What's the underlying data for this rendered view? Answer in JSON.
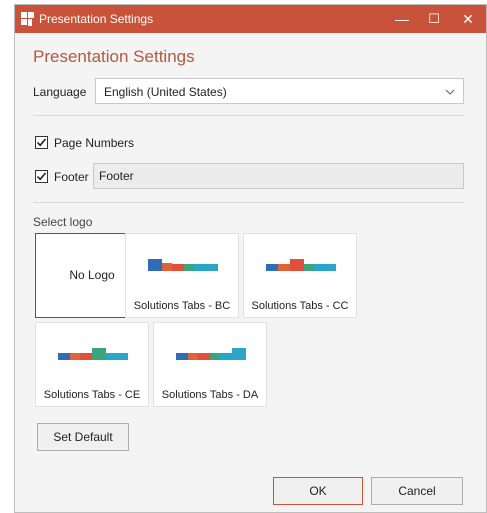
{
  "window": {
    "title": "Presentation Settings",
    "controls": {
      "minimize": "—",
      "maximize": "☐",
      "close": "✕"
    },
    "accent_color": "#c8533a"
  },
  "heading": "Presentation Settings",
  "language": {
    "label": "Language",
    "value": "English (United States)"
  },
  "page_numbers": {
    "label": "Page Numbers",
    "checked": true
  },
  "footer": {
    "label": "Footer",
    "checked": true,
    "value": "Footer"
  },
  "logo_section": {
    "label": "Select logo",
    "tiles": [
      {
        "caption": "No Logo",
        "selected": true
      },
      {
        "caption": "Solutions Tabs - BC"
      },
      {
        "caption": "Solutions Tabs - CC"
      },
      {
        "caption": "Solutions Tabs - CE"
      },
      {
        "caption": "Solutions Tabs - DA"
      }
    ]
  },
  "buttons": {
    "set_default": "Set Default",
    "ok": "OK",
    "cancel": "Cancel"
  }
}
